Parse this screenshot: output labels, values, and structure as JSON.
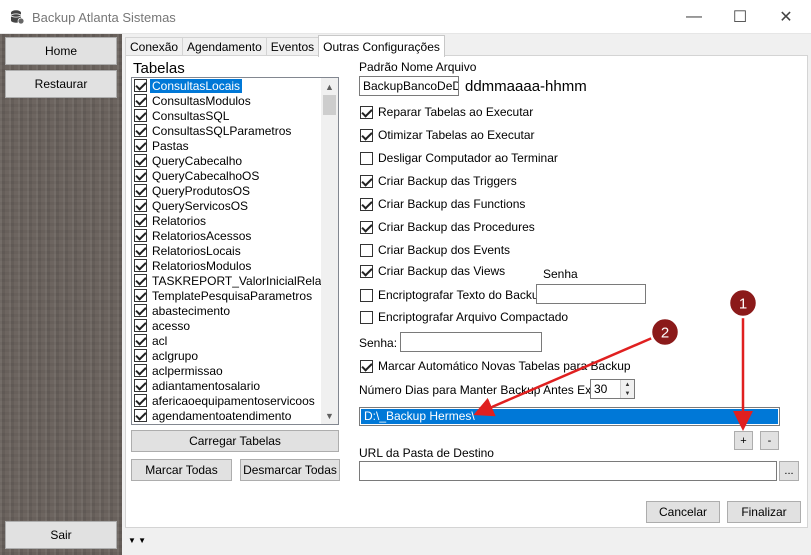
{
  "window": {
    "title": "Backup Atlanta Sistemas",
    "minimize": "—",
    "maximize": "☐",
    "close": "✕"
  },
  "sidebar": {
    "home": "Home",
    "restore": "Restaurar",
    "exit": "Sair"
  },
  "tabs": [
    "Conexão",
    "Agendamento",
    "Eventos",
    "Outras Configurações"
  ],
  "tables": {
    "label": "Tabelas",
    "items": [
      {
        "name": "ConsultasLocais",
        "checked": true,
        "selected": true
      },
      {
        "name": "ConsultasModulos",
        "checked": true
      },
      {
        "name": "ConsultasSQL",
        "checked": true
      },
      {
        "name": "ConsultasSQLParametros",
        "checked": true
      },
      {
        "name": "Pastas",
        "checked": true
      },
      {
        "name": "QueryCabecalho",
        "checked": true
      },
      {
        "name": "QueryCabecalhoOS",
        "checked": true
      },
      {
        "name": "QueryProdutosOS",
        "checked": true
      },
      {
        "name": "QueryServicosOS",
        "checked": true
      },
      {
        "name": "Relatorios",
        "checked": true
      },
      {
        "name": "RelatoriosAcessos",
        "checked": true
      },
      {
        "name": "RelatoriosLocais",
        "checked": true
      },
      {
        "name": "RelatoriosModulos",
        "checked": true
      },
      {
        "name": "TASKREPORT_ValorInicialRelatorio",
        "checked": true
      },
      {
        "name": "TemplatePesquisaParametros",
        "checked": true
      },
      {
        "name": "abastecimento",
        "checked": true
      },
      {
        "name": "acesso",
        "checked": true
      },
      {
        "name": "acl",
        "checked": true
      },
      {
        "name": "aclgrupo",
        "checked": true
      },
      {
        "name": "aclpermissao",
        "checked": true
      },
      {
        "name": "adiantamentosalario",
        "checked": true
      },
      {
        "name": "afericaoequipamentoservicoos",
        "checked": true
      },
      {
        "name": "agendamentoatendimento",
        "checked": true
      }
    ],
    "load_button": "Carregar Tabelas",
    "check_all_button": "Marcar Todas",
    "uncheck_all_button": "Desmarcar Todas"
  },
  "file_pattern": {
    "label": "Padrão Nome Arquivo",
    "value": "BackupBancoDeDados_",
    "format": "ddmmaaaa-hhmm"
  },
  "options": [
    {
      "label": "Reparar Tabelas ao Executar",
      "checked": true
    },
    {
      "label": "Otimizar Tabelas ao Executar",
      "checked": true
    },
    {
      "label": "Desligar Computador ao Terminar",
      "checked": false
    },
    {
      "label": "Criar Backup das Triggers",
      "checked": true
    },
    {
      "label": "Criar Backup das Functions",
      "checked": true
    },
    {
      "label": "Criar Backup das Procedures",
      "checked": true
    },
    {
      "label": "Criar Backup dos Events",
      "checked": false
    },
    {
      "label": "Criar Backup das Views",
      "checked": true
    },
    {
      "label": "Encriptografar Texto do Backup",
      "checked": false
    },
    {
      "label": "Encriptografar Arquivo Compactado",
      "checked": false
    }
  ],
  "password_label_top": "Senha",
  "password_label": "Senha:",
  "auto_check": {
    "label": "Marcar Automático Novas Tabelas para Backup",
    "checked": true
  },
  "retention": {
    "label": "Número Dias para Manter Backup Antes Excluir:",
    "value": "30"
  },
  "paths": {
    "items": [
      "D:\\_Backup Hermes\\"
    ],
    "add": "+",
    "remove": "-"
  },
  "destination": {
    "label": "URL da Pasta de Destino",
    "value": "",
    "browse": "..."
  },
  "footer": {
    "cancel": "Cancelar",
    "finish": "Finalizar",
    "arrows": "▼ ▼"
  },
  "annotations": [
    {
      "number": "1",
      "color": "#8b1a1a"
    },
    {
      "number": "2",
      "color": "#8b1a1a"
    }
  ],
  "colors": {
    "selection": "#0078d7",
    "annotation_red": "#e02020"
  }
}
